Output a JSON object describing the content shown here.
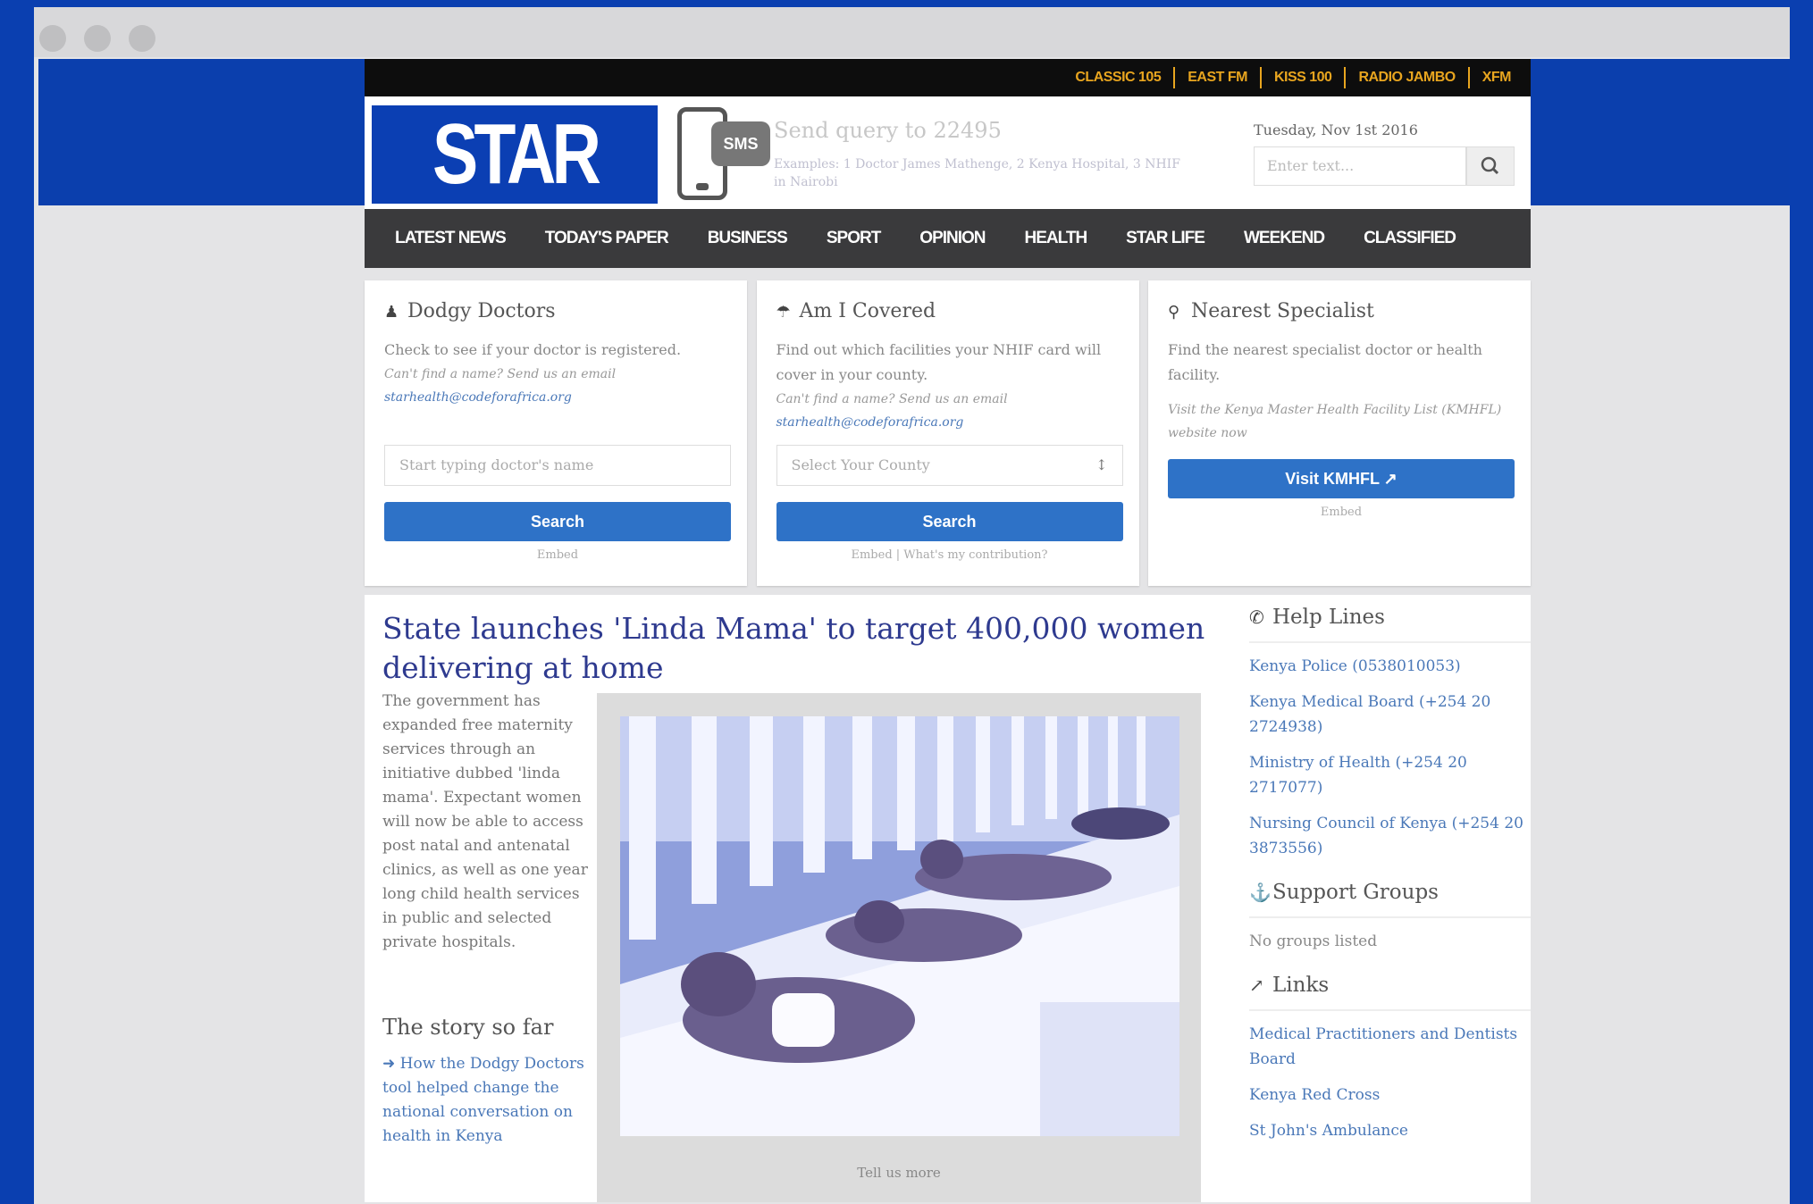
{
  "radio_links": [
    "CLASSIC 105",
    "EAST FM",
    "KISS 100",
    "RADIO JAMBO",
    "XFM"
  ],
  "logo": "STAR",
  "sms": {
    "badge": "SMS",
    "title": "Send query to 22495",
    "subtitle": "Examples: 1 Doctor James Mathenge, 2 Kenya Hospital, 3 NHIF in Nairobi"
  },
  "header": {
    "date": "Tuesday, Nov 1st 2016",
    "search_placeholder": "Enter text..."
  },
  "nav": [
    "LATEST NEWS",
    "TODAY'S PAPER",
    "BUSINESS",
    "SPORT",
    "OPINION",
    "HEALTH",
    "STAR LIFE",
    "WEEKEND",
    "CLASSIFIED"
  ],
  "cards": {
    "doctors": {
      "title": "Dodgy Doctors",
      "text": "Check to see if your doctor is registered.",
      "note": "Can't find a name? Send us an email",
      "email": "starhealth@codeforafrica.org",
      "placeholder": "Start typing doctor's name",
      "button": "Search",
      "footer": "Embed"
    },
    "covered": {
      "title": "Am I Covered",
      "text": "Find out which facilities your NHIF card will cover in your county.",
      "note": "Can't find a name? Send us an email",
      "email": "starhealth@codeforafrica.org",
      "select": "Select Your County",
      "button": "Search",
      "footer": "Embed | What's my contribution?"
    },
    "specialist": {
      "title": "Nearest Specialist",
      "text": "Find the nearest specialist doctor or health facility.",
      "note": "Visit the Kenya Master Health Facility List (KMHFL) website now",
      "button": "Visit KMHFL",
      "footer": "Embed"
    }
  },
  "article": {
    "headline": "State launches 'Linda Mama' to target 400,000 women delivering at home",
    "lede": "The government has expanded free maternity services through an initiative dubbed 'linda mama'. Expectant women will now be able to access post natal and antenatal clinics, as well as one year long child health services in public and selected private hospitals.",
    "story_heading": "The story so far",
    "story_link": "How the Dodgy Doctors tool helped change the national conversation on health in Kenya",
    "caption": "Tell us more"
  },
  "sidebar": {
    "helplines_title": "Help Lines",
    "helplines": [
      "Kenya Police (0538010053)",
      "Kenya Medical Board (+254 20 2724938)",
      "Ministry of Health (+254 20 2717077)",
      "Nursing Council of Kenya (+254 20 3873556)"
    ],
    "support_title": "Support Groups",
    "support_empty": "No groups listed",
    "links_title": "Links",
    "links": [
      "Medical Practitioners and Dentists Board",
      "Kenya Red Cross",
      "St John's Ambulance"
    ]
  },
  "colors": {
    "page_blue": "#0a3fb0",
    "logo_blue": "#0b3fb3",
    "nav_dark": "#3a3a3c",
    "button_blue": "#2e72c7",
    "headline": "#2e3a8f",
    "radio_gold": "#e8a51f"
  }
}
